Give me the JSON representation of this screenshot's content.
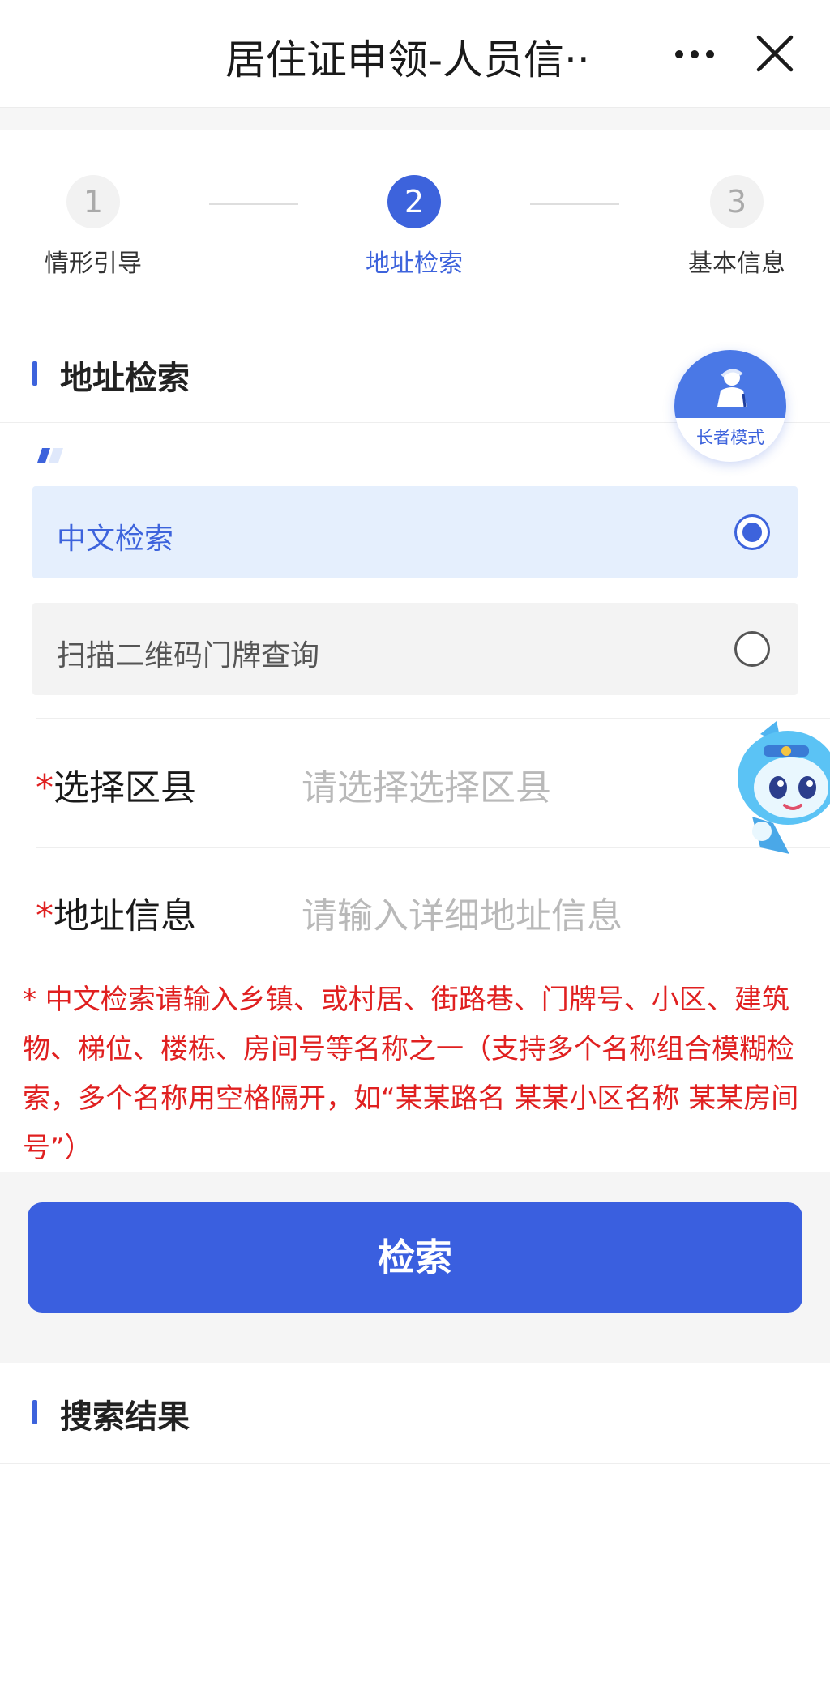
{
  "header": {
    "title": "居住证申领-人员信··",
    "more_icon": "more-dots-icon",
    "close_icon": "close-icon"
  },
  "stepper": {
    "steps": [
      {
        "number": "1",
        "label": "情形引导",
        "state": "inactive"
      },
      {
        "number": "2",
        "label": "地址检索",
        "state": "active"
      },
      {
        "number": "3",
        "label": "基本信息",
        "state": "inactive"
      }
    ]
  },
  "address_section": {
    "title": "地址检索"
  },
  "elder_mode": {
    "label": "长者模式",
    "icon": "elder-person-icon"
  },
  "search_options": [
    {
      "label": "中文检索",
      "selected": true
    },
    {
      "label": "扫描二维码门牌查询",
      "selected": false
    }
  ],
  "form": {
    "district": {
      "required_mark": "*",
      "label": "选择区县",
      "placeholder": "请选择选择区县"
    },
    "address": {
      "required_mark": "*",
      "label": "地址信息",
      "placeholder": "请输入详细地址信息"
    }
  },
  "hint": "* 中文检索请输入乡镇、或村居、街路巷、门牌号、小区、建筑物、梯位、楼栋、房间号等名称之一（支持多个名称组合模糊检索，多个名称用空格隔开，如“某某路名 某某小区名称 某某房间号”）",
  "search_button": {
    "label": "检索"
  },
  "results_section": {
    "title": "搜索结果"
  },
  "colors": {
    "accent": "#3d63dc",
    "button": "#3a5fdf",
    "warning": "#e02020",
    "selected_bg": "#e5effd"
  }
}
